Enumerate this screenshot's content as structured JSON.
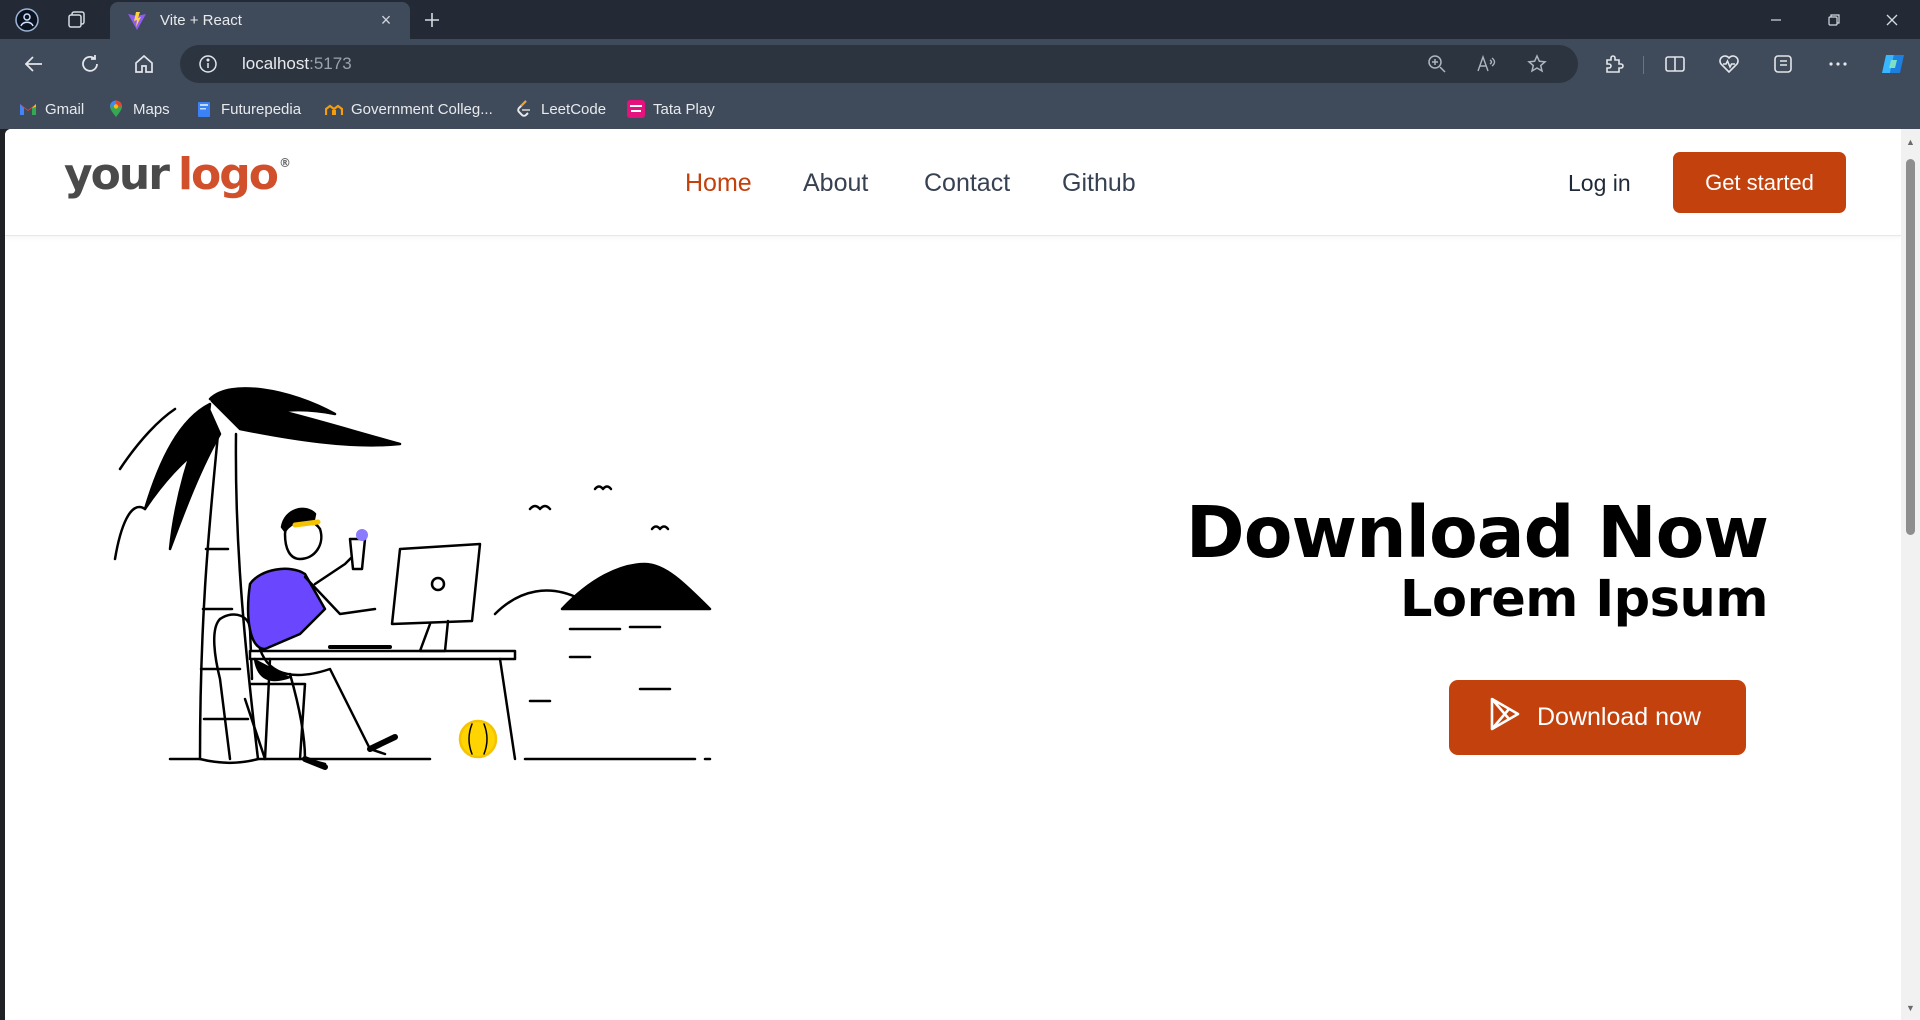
{
  "browser": {
    "tab_title": "Vite + React",
    "url_host": "localhost",
    "url_port": ":5173",
    "close_tab": "×",
    "bookmarks": [
      {
        "label": "Gmail",
        "icon": "gmail-icon"
      },
      {
        "label": "Maps",
        "icon": "maps-icon"
      },
      {
        "label": "Futurepedia",
        "icon": "futurepedia-icon"
      },
      {
        "label": "Government Colleg...",
        "icon": "college-icon"
      },
      {
        "label": "LeetCode",
        "icon": "leetcode-icon"
      },
      {
        "label": "Tata Play",
        "icon": "tataplay-icon"
      }
    ]
  },
  "site": {
    "logo": {
      "part1": "your",
      "part2": "logo",
      "mark": "®"
    },
    "nav": [
      "Home",
      "About",
      "Contact",
      "Github"
    ],
    "active_nav": "Home",
    "login": "Log in",
    "cta": "Get started"
  },
  "hero": {
    "title": "Download Now",
    "subtitle": "Lorem Ipsum",
    "button": "Download now",
    "button_icon": "play-store-icon",
    "illustration": "person-working-on-laptop-at-beach-illustration"
  },
  "colors": {
    "accent": "#c2410c",
    "chrome_dark": "#232a35",
    "chrome": "#3f4a5a"
  }
}
